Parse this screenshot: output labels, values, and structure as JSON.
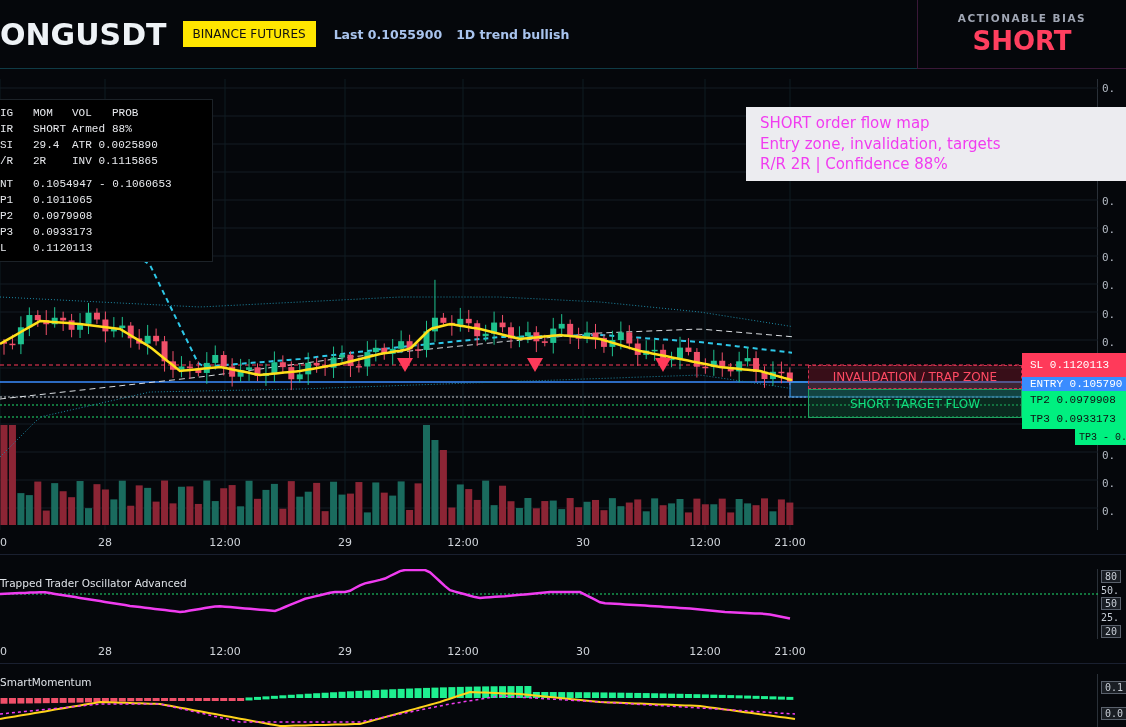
{
  "header": {
    "symbol": "ONGUSDT",
    "exchange_badge": "BINANCE FUTURES",
    "last": "Last 0.1055900",
    "trend": "1D trend bullish"
  },
  "bias": {
    "label": "ACTIONABLE BIAS",
    "value": "SHORT"
  },
  "signal_table": {
    "sections": [
      [
        [
          "IG",
          "MOM",
          "VOL",
          "PROB"
        ],
        [
          "IR",
          "SHORT",
          "Armed",
          "88%"
        ],
        [
          "SI",
          "29.4",
          "ATR 0.0025890"
        ],
        [
          "/R",
          "2R",
          "INV 0.1115865"
        ]
      ],
      [
        [
          "NT",
          "0.1054947 - 0.1060653"
        ],
        [
          "P1",
          "0.1011065"
        ],
        [
          "P2",
          "0.0979908"
        ],
        [
          "P3",
          "0.0933173"
        ],
        [
          "L",
          "0.1120113"
        ]
      ]
    ]
  },
  "callout": {
    "lines": [
      "SHORT order flow map",
      "Entry zone, invalidation, targets",
      "R/R 2R | Confidence 88%"
    ]
  },
  "zones": [
    {
      "kind": "invalidation",
      "label": "INVALIDATION / TRAP ZONE"
    },
    {
      "kind": "target",
      "label": "SHORT TARGET FLOW"
    }
  ],
  "price_tags": [
    {
      "kind": "sl",
      "label": "SL 0.1120113"
    },
    {
      "kind": "entry",
      "label": "ENTRY 0.105790"
    },
    {
      "kind": "tp",
      "label": "TP2 0.0979908"
    },
    {
      "kind": "tp",
      "label": "TP3 0.0933173"
    },
    {
      "kind": "tp_small",
      "label": "TP3 - 0."
    }
  ],
  "price_axis": [
    [
      "0."
    ],
    [
      "0.",
      "0.",
      "0.",
      "0.",
      "0.",
      "0."
    ],
    [
      "0.",
      "0.",
      "0."
    ]
  ],
  "time_axis": [
    "0",
    "28",
    "12:00",
    "29",
    "12:00",
    "30",
    "12:00",
    "21:00"
  ],
  "oscillator": {
    "title": "Trapped Trader Oscillator Advanced",
    "axis_labels": [
      {
        "kind": "tag",
        "text": "80"
      },
      {
        "kind": "plain",
        "text": "50."
      },
      {
        "kind": "tag",
        "text": "50"
      },
      {
        "kind": "plain",
        "text": "25."
      },
      {
        "kind": "tag",
        "text": "20"
      }
    ],
    "time_axis": [
      "0",
      "28",
      "12:00",
      "29",
      "12:00",
      "30",
      "12:00",
      "21:00"
    ]
  },
  "momentum": {
    "title": "SmartMomentum",
    "axis_labels": [
      "0.1",
      "0.0"
    ]
  }
}
